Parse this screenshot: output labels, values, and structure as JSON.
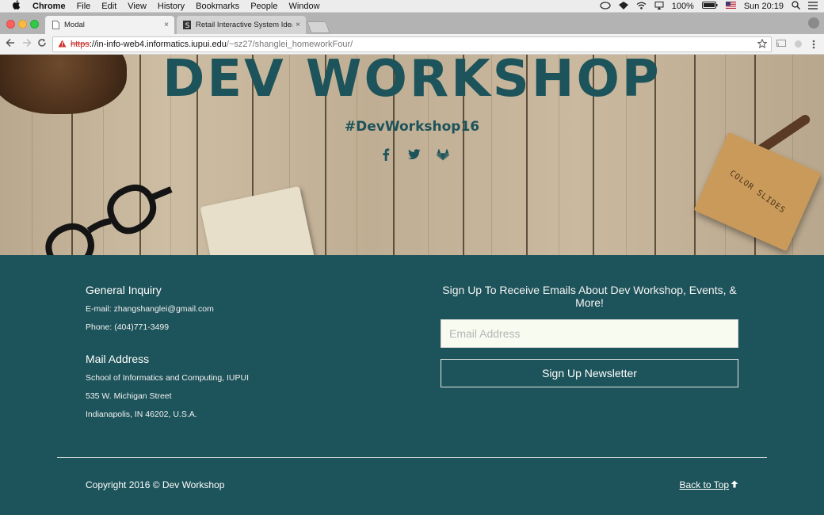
{
  "menubar": {
    "app": "Chrome",
    "items": [
      "File",
      "Edit",
      "View",
      "History",
      "Bookmarks",
      "People",
      "Window"
    ],
    "battery": "100%",
    "clock": "Sun 20:19"
  },
  "tabs": [
    {
      "title": "Modal",
      "close": "×"
    },
    {
      "title": "Retail Interactive System Ideas",
      "close": "×"
    }
  ],
  "address": {
    "scheme": "https",
    "host": "://in-info-web4.informatics.iupui.edu",
    "path": "/~sz27/shanglei_homeworkFour/"
  },
  "hero": {
    "title": "DEV WORKSHOP",
    "hashtag": "#DevWorkshop16",
    "box_label": "COLOR SLIDES"
  },
  "contact": {
    "inquiry_heading": "General Inquiry",
    "email": "E-mail: zhangshanglei@gmail.com",
    "phone": "Phone: (404)771-3499",
    "mail_heading": "Mail Address",
    "address_line1": "School of Informatics and Computing, IUPUI",
    "address_line2": "535 W. Michigan Street",
    "address_line3": "Indianapolis, IN 46202, U.S.A."
  },
  "newsletter": {
    "prompt": "Sign Up To Receive Emails About Dev Workshop, Events, & More!",
    "email_placeholder": "Email Address",
    "button": "Sign Up Newsletter"
  },
  "footer": {
    "copyright": "Copyright 2016 © Dev Workshop",
    "back_to_top": "Back to Top"
  },
  "colors": {
    "teal": "#1d535a",
    "chrome_frame": "#b3b3b3"
  }
}
